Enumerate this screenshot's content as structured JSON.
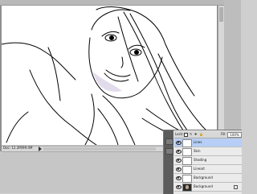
{
  "document": {
    "status_text": "Doc: 12.2M/99.4M",
    "canvas_label": "line-art-portrait"
  },
  "layers_panel": {
    "blend_mode": "Lock:",
    "fill_label": "Fill:",
    "fill_value": "100%",
    "layers": [
      {
        "name": "Lines",
        "selected": true,
        "thumb": "white"
      },
      {
        "name": "Skin",
        "selected": false,
        "thumb": "white"
      },
      {
        "name": "Shading",
        "selected": false,
        "thumb": "white"
      },
      {
        "name": "Lineart",
        "selected": false,
        "thumb": "white"
      },
      {
        "name": "Background",
        "selected": false,
        "thumb": "white"
      },
      {
        "name": "Background",
        "selected": false,
        "thumb": "dark"
      }
    ]
  },
  "colors": {
    "selected_row": "#b7cff7",
    "panel_bg": "#e6e6e6"
  }
}
